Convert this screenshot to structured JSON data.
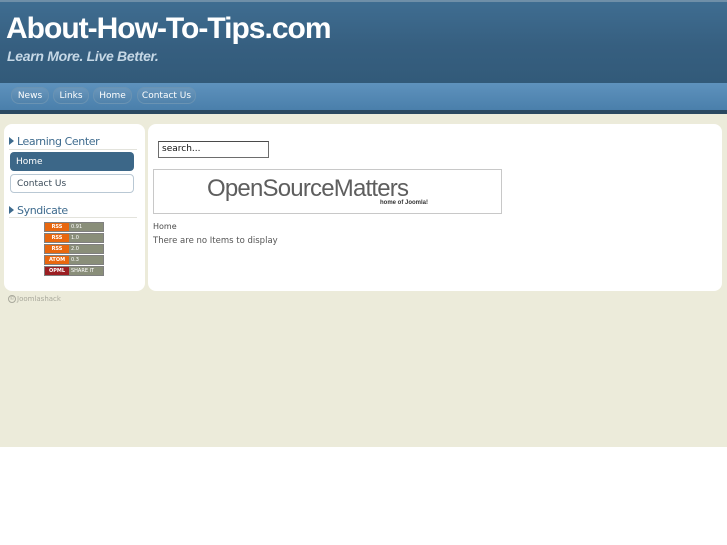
{
  "header": {
    "site_title": "About-How-To-Tips.com",
    "slogan": "Learn More. Live Better."
  },
  "nav": {
    "items": [
      "News",
      "Links",
      "Home",
      "Contact Us"
    ]
  },
  "left": {
    "learning_center": {
      "title": "Learning Center",
      "items": [
        "Home",
        "Contact Us"
      ]
    },
    "syndicate": {
      "title": "Syndicate",
      "feeds": [
        {
          "label": "RSS",
          "version": "0.91",
          "color": "#e8670f"
        },
        {
          "label": "RSS",
          "version": "1.0",
          "color": "#e8670f"
        },
        {
          "label": "RSS",
          "version": "2.0",
          "color": "#e8670f"
        },
        {
          "label": "ATOM",
          "version": "0.3",
          "color": "#e8670f"
        },
        {
          "label": "OPML",
          "version": "SHARE IT",
          "color": "#9b1e22"
        }
      ]
    }
  },
  "main": {
    "search_value": "search...",
    "banner": {
      "main_left": "OpenSource",
      "main_right": "Matters",
      "sub": "home of Joomla!"
    },
    "breadcrumb": "Home",
    "empty_message": "There are no Items to display"
  },
  "footer": {
    "credit": "Joomlashack"
  }
}
